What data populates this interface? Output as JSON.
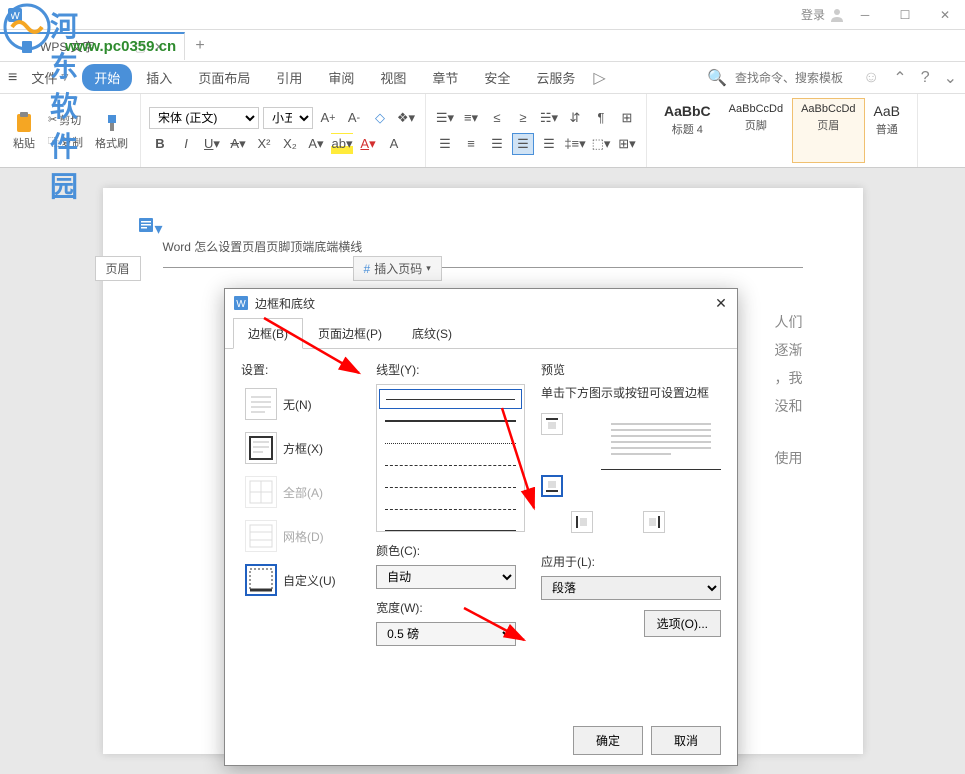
{
  "titlebar": {
    "login": "登录"
  },
  "watermark": {
    "site": "河东软件园",
    "url": "www.pc0359.cn"
  },
  "doctab": {
    "name": "WPS 文字",
    "new": "+"
  },
  "menu": {
    "file": "文件",
    "start": "开始",
    "insert": "插入",
    "layout": "页面布局",
    "reference": "引用",
    "review": "审阅",
    "view": "视图",
    "chapter": "章节",
    "security": "安全",
    "cloud": "云服务",
    "search_placeholder": "查找命令、搜索模板"
  },
  "ribbon": {
    "paste": "粘贴",
    "cut": "剪切",
    "copy": "复制",
    "format_painter": "格式刷",
    "font": "宋体 (正文)",
    "size": "小五",
    "style1_preview": "AaBbC",
    "style1_name": "标题 4",
    "style2_preview": "AaBbCcDd",
    "style2_name": "页脚",
    "style3_preview": "AaBbCcDd",
    "style3_name": "页眉",
    "style4_preview": "AaB",
    "style4_name": "普通"
  },
  "document": {
    "header_label": "页眉",
    "header_text": "Word 怎么设置页眉页脚顶端底端横线",
    "insert_pagenum": "插入页码",
    "body_text_1": "人们",
    "body_text_2": "逐渐",
    "body_text_3": "，我",
    "body_text_4": "没和",
    "body_text_5": "使用"
  },
  "dialog": {
    "title": "边框和底纹",
    "tab_border": "边框(B)",
    "tab_page_border": "页面边框(P)",
    "tab_shading": "底纹(S)",
    "settings_label": "设置:",
    "option_none": "无(N)",
    "option_box": "方框(X)",
    "option_all": "全部(A)",
    "option_grid": "网格(D)",
    "option_custom": "自定义(U)",
    "line_label": "线型(Y):",
    "color_label": "颜色(C):",
    "color_value": "自动",
    "width_label": "宽度(W):",
    "width_value": "0.5   磅",
    "preview_label": "预览",
    "preview_hint": "单击下方图示或按钮可设置边框",
    "apply_label": "应用于(L):",
    "apply_value": "段落",
    "options_btn": "选项(O)...",
    "ok": "确定",
    "cancel": "取消"
  }
}
